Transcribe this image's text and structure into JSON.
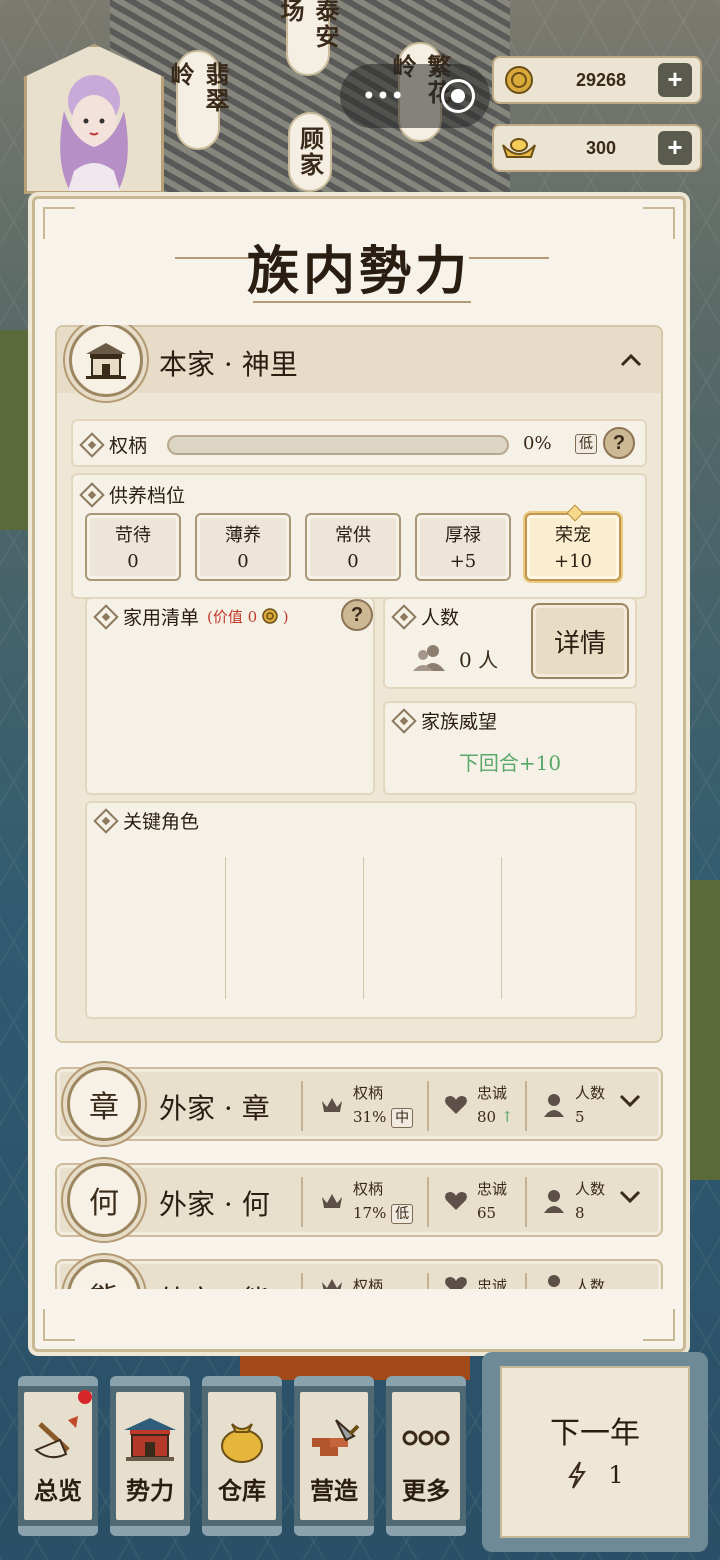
{
  "map": {
    "places": [
      "泰安场",
      "翡翠岭",
      "繁花岭",
      "顾家"
    ]
  },
  "capsule": {
    "more": "•••",
    "record": "◉"
  },
  "currency": {
    "coins": {
      "icon": "coin-icon",
      "amount": "29268",
      "plus": "+"
    },
    "ingots": {
      "icon": "ingot-icon",
      "amount": "300",
      "plus": "+"
    }
  },
  "panel": {
    "title": "族内勢力",
    "main_family": {
      "name": "本家 · 神里",
      "collapse_icon": "^",
      "power": {
        "label": "权柄",
        "value": "0%",
        "level": "低",
        "help": "?",
        "progress": 0
      },
      "tiers": {
        "label": "供养档位",
        "items": [
          {
            "name": "苛待",
            "value": "0"
          },
          {
            "name": "薄养",
            "value": "0"
          },
          {
            "name": "常供",
            "value": "0"
          },
          {
            "name": "厚禄",
            "value": "+5"
          },
          {
            "name": "荣宠",
            "value": "+10"
          }
        ],
        "active_index": 4
      },
      "household": {
        "label": "家用清单",
        "value_prefix": "(价值 0",
        "value_suffix": ")",
        "help": "?"
      },
      "headcount": {
        "label": "人数",
        "value": "0 人",
        "detail": "详情"
      },
      "prestige": {
        "label": "家族威望",
        "value": "下回合+10"
      },
      "key_roles": {
        "label": "关键角色"
      }
    },
    "external_families": [
      {
        "emblem": "章",
        "name": "外家 · 章",
        "power_label": "权柄",
        "power": "31%",
        "power_level": "中",
        "loyalty_label": "忠诚",
        "loyalty": "80",
        "loyalty_trend": "↑",
        "count_label": "人数",
        "count": "5"
      },
      {
        "emblem": "何",
        "name": "外家 · 何",
        "power_label": "权柄",
        "power": "17%",
        "power_level": "低",
        "loyalty_label": "忠诚",
        "loyalty": "65",
        "loyalty_trend": "",
        "count_label": "人数",
        "count": "8"
      },
      {
        "emblem": "熊",
        "name": "外家 · 熊",
        "power_label": "权柄",
        "power": "",
        "power_level": "",
        "loyalty_label": "忠诚",
        "loyalty": "",
        "loyalty_trend": "",
        "count_label": "人数",
        "count": ""
      }
    ]
  },
  "bottom_nav": [
    {
      "label": "总览",
      "icon": "brush-icon",
      "badge": true
    },
    {
      "label": "势力",
      "icon": "palace-icon",
      "badge": false
    },
    {
      "label": "仓库",
      "icon": "bag-icon",
      "badge": false
    },
    {
      "label": "营造",
      "icon": "trowel-icon",
      "badge": false
    },
    {
      "label": "更多",
      "icon": "more-icon",
      "badge": false
    }
  ],
  "next_year": {
    "label": "下一年",
    "icon": "lightning-icon",
    "count": "1"
  },
  "colors": {
    "accent_green": "#5aa86a",
    "red_text": "#c0392b",
    "badge_red": "#d8262a"
  }
}
